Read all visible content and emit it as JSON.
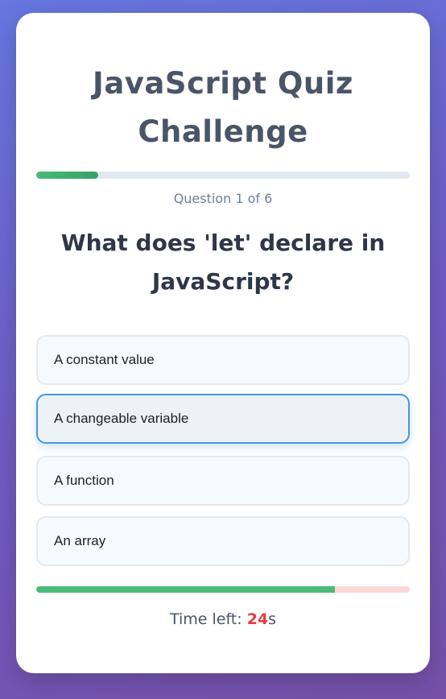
{
  "quiz": {
    "title_line1": "JavaScript Quiz",
    "title_line2": "Challenge",
    "progress_fraction": 0.1667,
    "question_counter": "Question 1 of 6",
    "question_text": "What does 'let' declare in JavaScript?",
    "options": [
      {
        "label": "A constant value",
        "selected": false
      },
      {
        "label": "A changeable variable",
        "selected": true
      },
      {
        "label": "A function",
        "selected": false
      },
      {
        "label": "An array",
        "selected": false
      }
    ],
    "timer": {
      "label": "Time left: ",
      "seconds": "24",
      "unit": "s",
      "remaining_fraction": 0.8
    }
  },
  "colors": {
    "accent_green": "#48bb78",
    "selected_border": "#4299e1",
    "timer_red": "#e53e3e"
  }
}
